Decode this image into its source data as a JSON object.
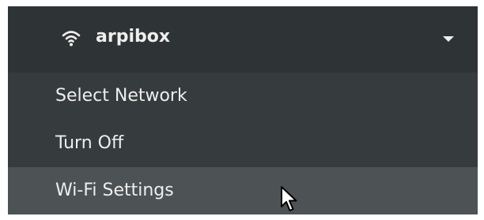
{
  "menu": {
    "header": {
      "network_name": "arpibox",
      "icon": "wifi-icon",
      "expand_icon": "chevron-down-icon"
    },
    "items": [
      {
        "label": "Select Network"
      },
      {
        "label": "Turn Off"
      },
      {
        "label": "Wi-Fi Settings",
        "hovered": true
      }
    ]
  },
  "cursor": {
    "icon": "mouse-pointer-icon"
  },
  "colors": {
    "header_bg": "#2e3436",
    "menu_bg": "#363c3e",
    "hover_bg": "#4d5355",
    "text": "#eeeeec"
  }
}
